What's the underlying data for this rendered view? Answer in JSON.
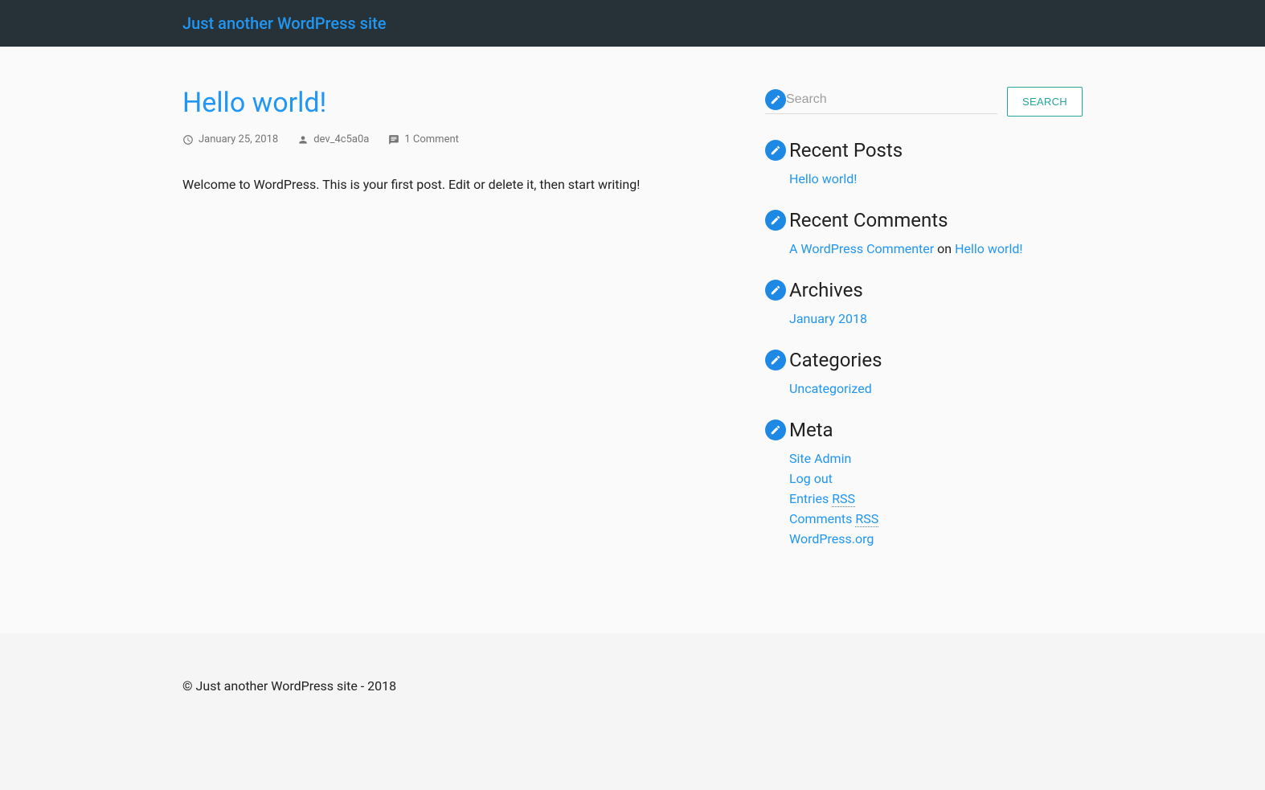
{
  "header": {
    "site_title": "Just another WordPress site"
  },
  "post": {
    "title": "Hello world!",
    "date": "January 25, 2018",
    "author": "dev_4c5a0a",
    "comments": "1 Comment",
    "body": "Welcome to WordPress. This is your first post. Edit or delete it, then start writing!"
  },
  "search": {
    "placeholder": "Search",
    "button": "SEARCH"
  },
  "widgets": {
    "recent_posts": {
      "title": "Recent Posts",
      "items": [
        "Hello world!"
      ]
    },
    "recent_comments": {
      "title": "Recent Comments",
      "items": [
        {
          "author": "A WordPress Commenter",
          "on": " on ",
          "post": "Hello world!"
        }
      ]
    },
    "archives": {
      "title": "Archives",
      "items": [
        "January 2018"
      ]
    },
    "categories": {
      "title": "Categories",
      "items": [
        "Uncategorized"
      ]
    },
    "meta": {
      "title": "Meta",
      "items": [
        {
          "text": "Site Admin"
        },
        {
          "text": "Log out"
        },
        {
          "prefix": "Entries ",
          "abbr": "RSS"
        },
        {
          "prefix": "Comments ",
          "abbr": "RSS"
        },
        {
          "text": "WordPress.org"
        }
      ]
    }
  },
  "footer": {
    "text": "© Just another WordPress site - 2018"
  }
}
